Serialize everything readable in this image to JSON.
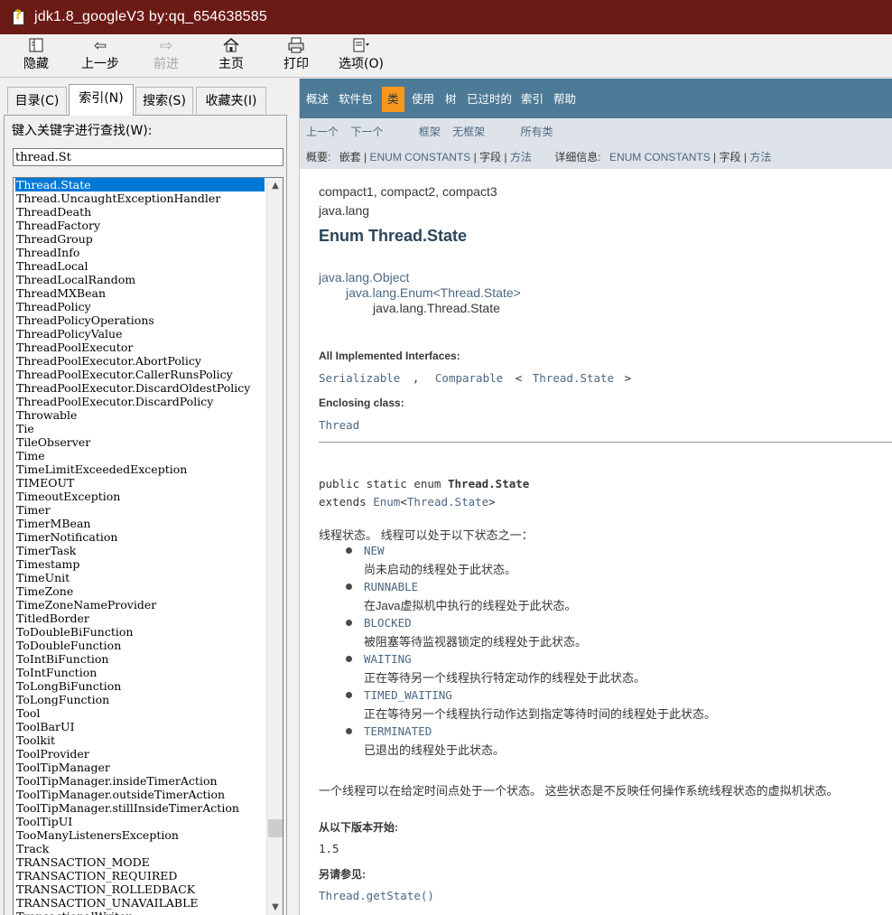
{
  "window": {
    "title": "jdk1.8_googleV3 by:qq_654638585"
  },
  "toolbar": {
    "hide": "隐藏",
    "back": "上一步",
    "forward": "前进",
    "home": "主页",
    "print": "打印",
    "options": "选项(O)"
  },
  "tabs": {
    "contents": "目录(C)",
    "index": "索引(N)",
    "search": "搜索(S)",
    "favorites": "收藏夹(I)"
  },
  "index": {
    "label": "键入关键字进行查找(W):",
    "query": "thread.St",
    "items": [
      "Thread.State",
      "Thread.UncaughtExceptionHandler",
      "ThreadDeath",
      "ThreadFactory",
      "ThreadGroup",
      "ThreadInfo",
      "ThreadLocal",
      "ThreadLocalRandom",
      "ThreadMXBean",
      "ThreadPolicy",
      "ThreadPolicyOperations",
      "ThreadPolicyValue",
      "ThreadPoolExecutor",
      "ThreadPoolExecutor.AbortPolicy",
      "ThreadPoolExecutor.CallerRunsPolicy",
      "ThreadPoolExecutor.DiscardOldestPolicy",
      "ThreadPoolExecutor.DiscardPolicy",
      "Throwable",
      "Tie",
      "TileObserver",
      "Time",
      "TimeLimitExceededException",
      "TIMEOUT",
      "TimeoutException",
      "Timer",
      "TimerMBean",
      "TimerNotification",
      "TimerTask",
      "Timestamp",
      "TimeUnit",
      "TimeZone",
      "TimeZoneNameProvider",
      "TitledBorder",
      "ToDoubleBiFunction",
      "ToDoubleFunction",
      "ToIntBiFunction",
      "ToIntFunction",
      "ToLongBiFunction",
      "ToLongFunction",
      "Tool",
      "ToolBarUI",
      "Toolkit",
      "ToolProvider",
      "ToolTipManager",
      "ToolTipManager.insideTimerAction",
      "ToolTipManager.outsideTimerAction",
      "ToolTipManager.stillInsideTimerAction",
      "ToolTipUI",
      "TooManyListenersException",
      "Track",
      "TRANSACTION_MODE",
      "TRANSACTION_REQUIRED",
      "TRANSACTION_ROLLEDBACK",
      "TRANSACTION_UNAVAILABLE",
      "TransactionalWriter"
    ],
    "selected_index": 0
  },
  "doc": {
    "topnav": [
      "概述",
      "软件包",
      "类",
      "使用",
      "树",
      "已过时的",
      "索引",
      "帮助"
    ],
    "topnav_current": "类",
    "subnav": {
      "prev": "上一个",
      "next": "下一个",
      "frames": "框架",
      "noframes": "无框架",
      "allclasses": "所有类",
      "summary_label": "概要:",
      "nested": "嵌套",
      "enum_constants": "ENUM CONSTANTS",
      "field": "字段",
      "method": "方法",
      "detail_label": "详细信息:",
      "detail_enum_constants": "ENUM CONSTANTS",
      "detail_field": "字段",
      "detail_method": "方法"
    },
    "modules": "compact1, compact2, compact3",
    "package": "java.lang",
    "title": "Enum Thread.State",
    "inheritance": [
      "java.lang.Object",
      "java.lang.Enum<Thread.State>",
      "java.lang.Thread.State"
    ],
    "all_interfaces_label": "All Implemented Interfaces:",
    "interfaces": {
      "serializable": "Serializable",
      "comma": ",",
      "comparable": "Comparable",
      "lt": "<",
      "threadstate": "Thread.State",
      "gt": ">"
    },
    "enclosing_label": "Enclosing class:",
    "enclosing_class": "Thread",
    "signature": {
      "modifiers": "public static enum ",
      "name": "Thread.State",
      "extends_kw": "extends ",
      "enum_link": "Enum",
      "lt": "<",
      "param": "Thread.State",
      "gt": ">"
    },
    "description": "线程状态。 线程可以处于以下状态之一：",
    "states": [
      {
        "name": "NEW",
        "text": "尚未启动的线程处于此状态。"
      },
      {
        "name": "RUNNABLE",
        "text": "在Java虚拟机中执行的线程处于此状态。"
      },
      {
        "name": "BLOCKED",
        "text": "被阻塞等待监视器锁定的线程处于此状态。"
      },
      {
        "name": "WAITING",
        "text": "正在等待另一个线程执行特定动作的线程处于此状态。"
      },
      {
        "name": "TIMED_WAITING",
        "text": "正在等待另一个线程执行动作达到指定等待时间的线程处于此状态。"
      },
      {
        "name": "TERMINATED",
        "text": "已退出的线程处于此状态。"
      }
    ],
    "note": "一个线程可以在给定时间点处于一个状态。 这些状态是不反映任何操作系统线程状态的虚拟机状态。",
    "since_label": "从以下版本开始:",
    "since": "1.5",
    "see_also_label": "另请参见:",
    "see_also": "Thread.getState()"
  },
  "colors": {
    "titlebar": "#6b1a16",
    "topnav": "#4d7a97",
    "topnav_current": "#f8981d",
    "subnav": "#dee3e9",
    "link": "#4a6782",
    "selection": "#0078d7"
  }
}
